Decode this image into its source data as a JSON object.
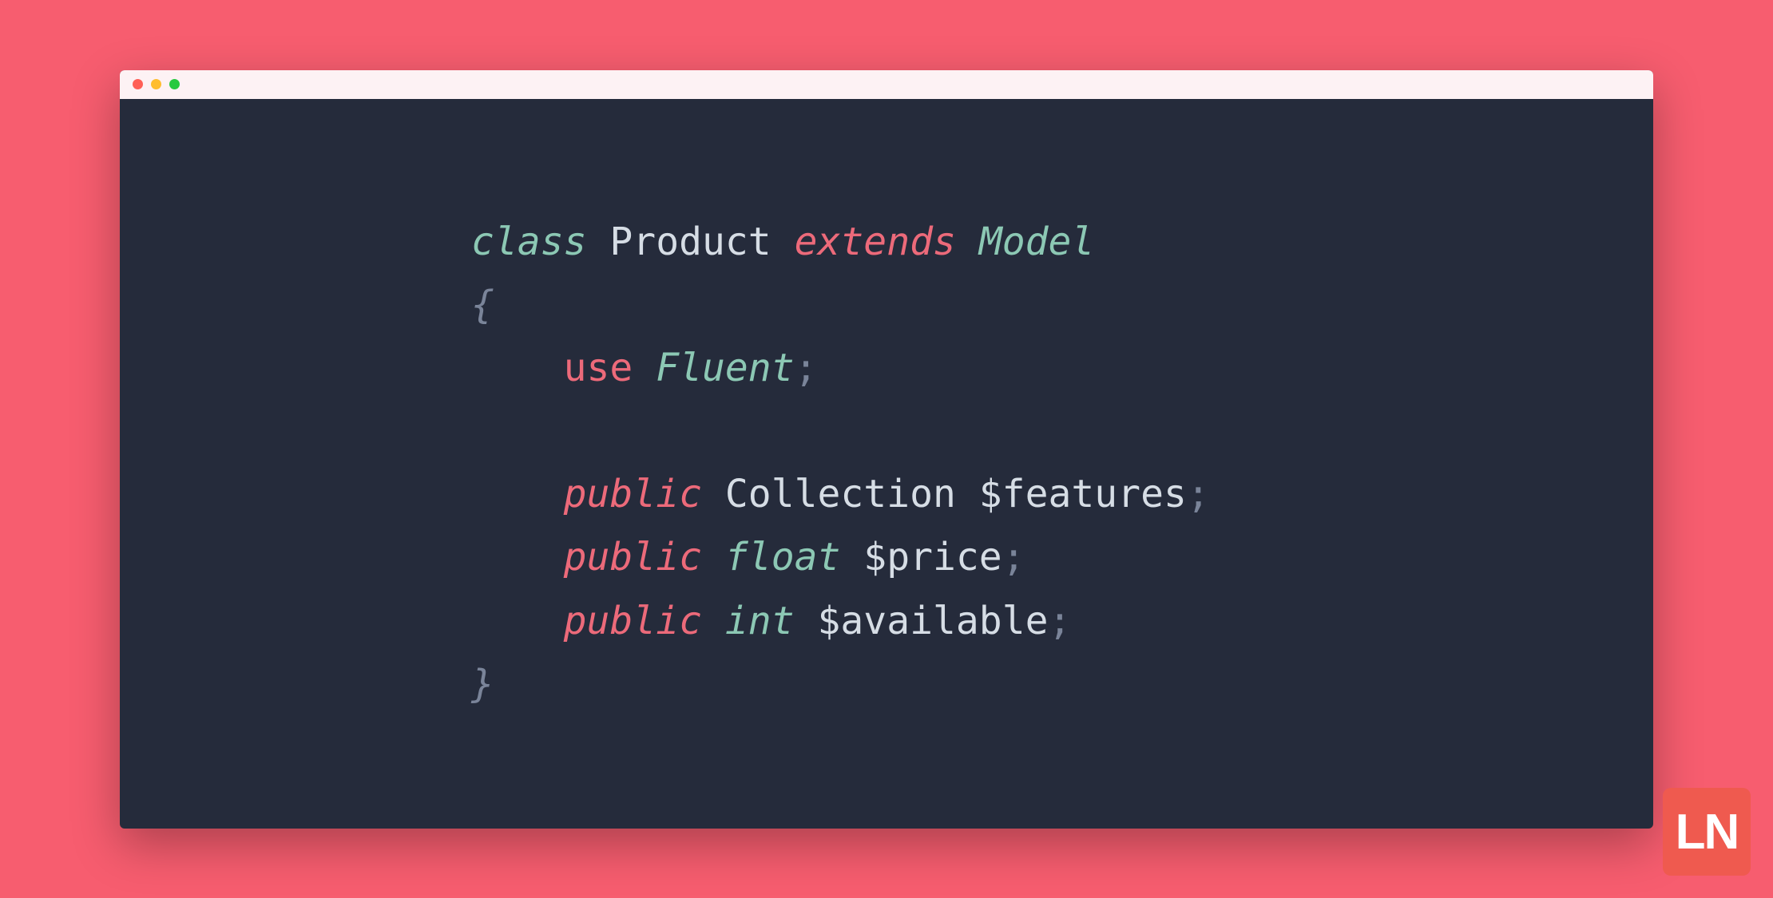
{
  "code": {
    "line1": {
      "class_kw": "class",
      "class_name": "Product",
      "extends_kw": "extends",
      "parent_class": "Model"
    },
    "open_brace": "{",
    "line3": {
      "use_kw": "use",
      "trait": "Fluent",
      "semi": ";"
    },
    "prop1": {
      "visibility": "public",
      "type": "Collection",
      "name": "$features",
      "semi": ";"
    },
    "prop2": {
      "visibility": "public",
      "type": "float",
      "name": "$price",
      "semi": ";"
    },
    "prop3": {
      "visibility": "public",
      "type": "int",
      "name": "$available",
      "semi": ";"
    },
    "close_brace": "}"
  },
  "logo": "LN"
}
